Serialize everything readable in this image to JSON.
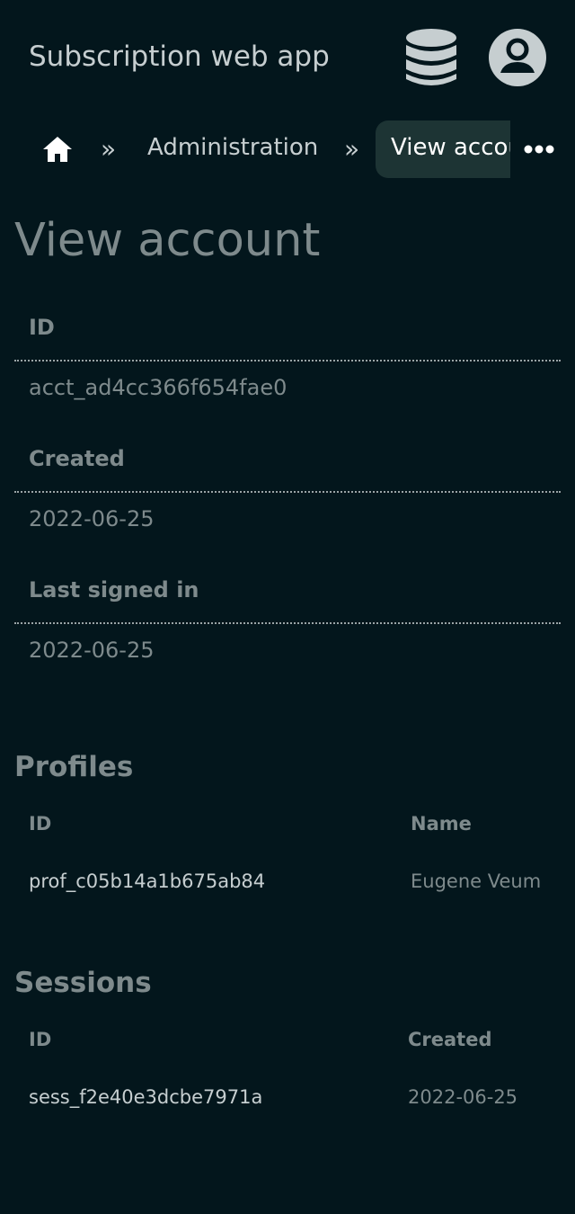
{
  "header": {
    "app_title": "Subscription web app",
    "db_icon": "database-icon",
    "account_icon": "account-circle-icon"
  },
  "breadcrumb": {
    "home_icon": "home-icon",
    "separator": "»",
    "items": [
      {
        "label": "Administration"
      },
      {
        "label": "View account"
      }
    ],
    "more_icon": "more-horizontal-icon"
  },
  "page": {
    "title": "View account"
  },
  "account": {
    "fields": [
      {
        "label": "ID",
        "value": "acct_ad4cc366f654fae0"
      },
      {
        "label": "Created",
        "value": "2022-06-25"
      },
      {
        "label": "Last signed in",
        "value": "2022-06-25"
      }
    ]
  },
  "profiles": {
    "heading": "Profiles",
    "columns": [
      "ID",
      "Name"
    ],
    "rows": [
      [
        "prof_c05b14a1b675ab84",
        "Eugene Veum"
      ]
    ]
  },
  "sessions": {
    "heading": "Sessions",
    "columns": [
      "ID",
      "Created"
    ],
    "rows": [
      [
        "sess_f2e40e3dcbe7971a",
        "2022-06-25"
      ]
    ]
  },
  "colors": {
    "background": "#03161c",
    "text_light": "#c6ced0",
    "text_muted": "#7e8a8c",
    "crumb_active_bg": "#1d3434"
  }
}
